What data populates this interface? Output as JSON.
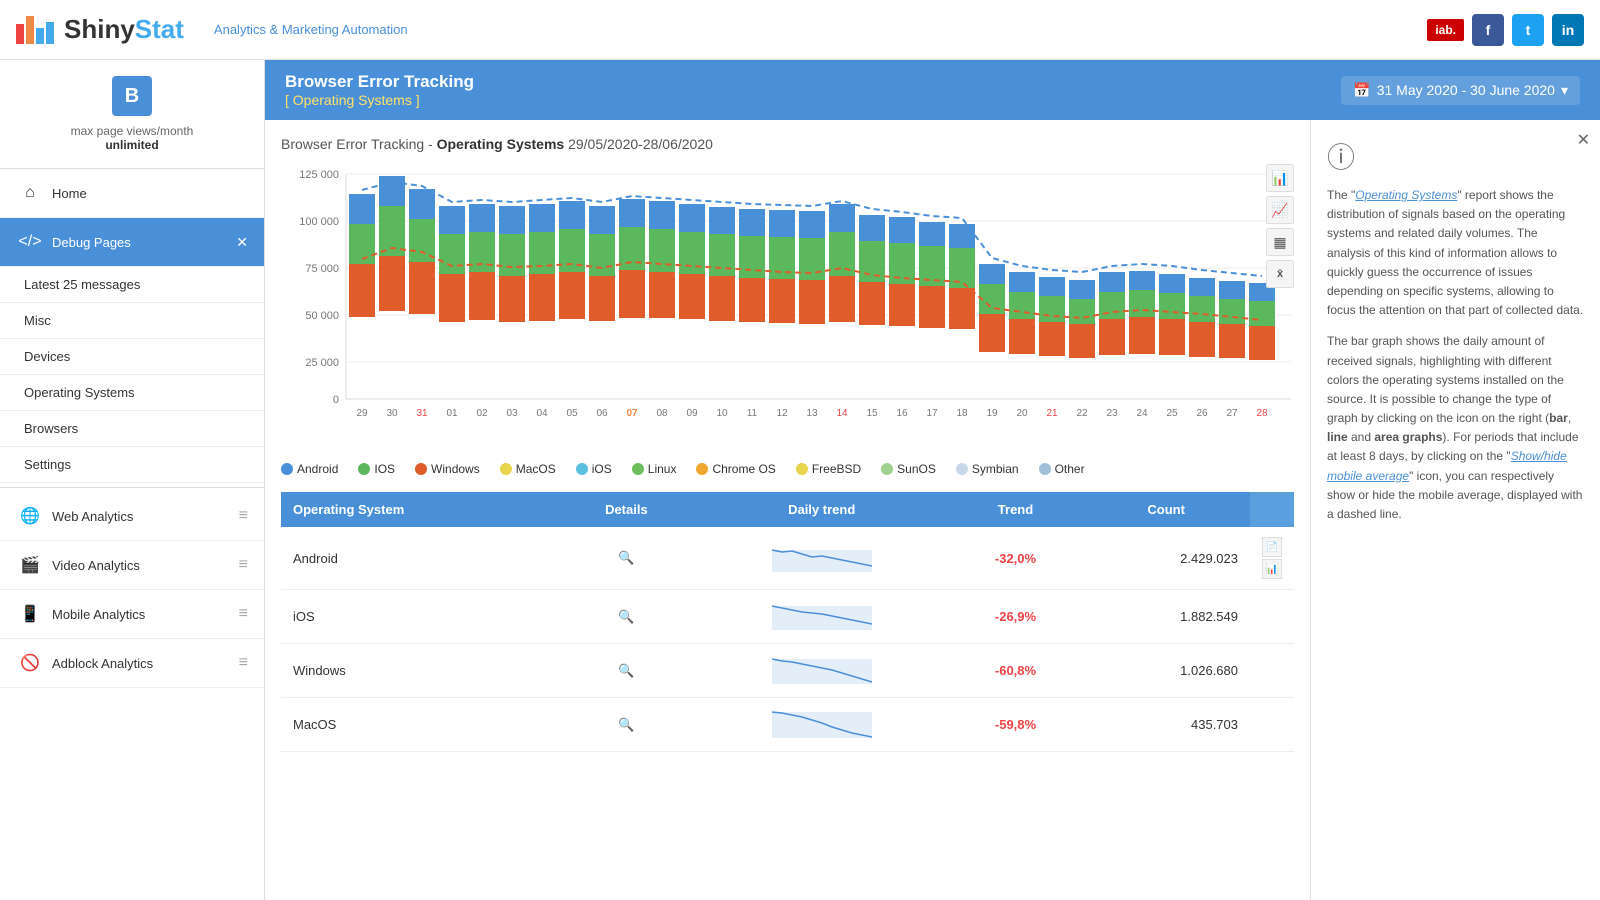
{
  "header": {
    "logo_text_dark": "Shiny",
    "logo_text_light": "Stat",
    "tagline": "Analytics & Marketing Automation",
    "social": [
      "f",
      "t",
      "in"
    ]
  },
  "user": {
    "icon": "B",
    "info_label": "max page views/month",
    "info_value": "unlimited"
  },
  "nav": {
    "home": "Home",
    "debug_pages": "Debug Pages",
    "items": [
      "Latest 25 messages",
      "Misc",
      "Devices",
      "Operating Systems",
      "Browsers",
      "Settings"
    ]
  },
  "analytics_sections": [
    {
      "label": "Web Analytics",
      "icon": "globe"
    },
    {
      "label": "Video Analytics",
      "icon": "video"
    },
    {
      "label": "Mobile Analytics",
      "icon": "mobile"
    },
    {
      "label": "Adblock Analytics",
      "icon": "block"
    }
  ],
  "page_header": {
    "title": "Browser Error Tracking",
    "subtitle": "[ Operating Systems ]",
    "date_range": "31 May 2020 - 30 June 2020"
  },
  "chart": {
    "title_prefix": "Browser Error Tracking - ",
    "title_bold": "Operating Systems",
    "date": "29/05/2020-28/06/2020",
    "y_labels": [
      "125 000",
      "100 000",
      "75 000",
      "50 000",
      "25 000",
      "0"
    ],
    "x_labels": [
      "29",
      "30",
      "31",
      "01",
      "02",
      "03",
      "04",
      "05",
      "06",
      "07",
      "08",
      "09",
      "10",
      "11",
      "12",
      "13",
      "14",
      "15",
      "16",
      "17",
      "18",
      "19",
      "20",
      "21",
      "22",
      "23",
      "24",
      "25",
      "26",
      "27",
      "28"
    ],
    "x_red": [
      31,
      14,
      21,
      28
    ],
    "legend": [
      {
        "label": "Android",
        "color": "#4a90d9"
      },
      {
        "label": "IOS",
        "color": "#5cb85c"
      },
      {
        "label": "Windows",
        "color": "#e05c2a"
      },
      {
        "label": "MacOS",
        "color": "#e8d44d"
      },
      {
        "label": "iOS",
        "color": "#5bc0de"
      },
      {
        "label": "Linux",
        "color": "#6dbf5e"
      },
      {
        "label": "Chrome OS",
        "color": "#f0a830"
      },
      {
        "label": "FreeBSD",
        "color": "#e8d44d"
      },
      {
        "label": "SunOS",
        "color": "#a0d090"
      },
      {
        "label": "Symbian",
        "color": "#c8d8e8"
      },
      {
        "label": "Other",
        "color": "#a0c0d8"
      }
    ]
  },
  "table": {
    "headers": [
      "Operating System",
      "Details",
      "Daily trend",
      "Trend",
      "Count"
    ],
    "rows": [
      {
        "os": "Android",
        "trend_pct": "-32,0%",
        "count": "2.429.023"
      },
      {
        "os": "iOS",
        "trend_pct": "-26,9%",
        "count": "1.882.549"
      },
      {
        "os": "Windows",
        "trend_pct": "-60,8%",
        "count": "1.026.680"
      },
      {
        "os": "MacOS",
        "trend_pct": "-59,8%",
        "count": "435.703"
      }
    ]
  },
  "info_panel": {
    "para1": "The \"Operating Systems\" report shows the distribution of signals based on the operating systems and related daily volumes. The analysis of this kind of information allows to quickly guess the occurrence of issues depending on specific systems, allowing to focus the attention on that part of collected data.",
    "para2": "The bar graph shows the daily amount of received signals, highlighting with different colors the operating systems installed on the source. It is possible to change the type of graph by clicking on the icon on the right (bar, line and area graphs). For periods that include at least 8 days, by clicking on the \"Show/hide mobile average\" icon, you can respectively show or hide the mobile average, displayed with a dashed line.",
    "italic1": "Operating Systems",
    "italic2": "Show/hide mobile average"
  }
}
